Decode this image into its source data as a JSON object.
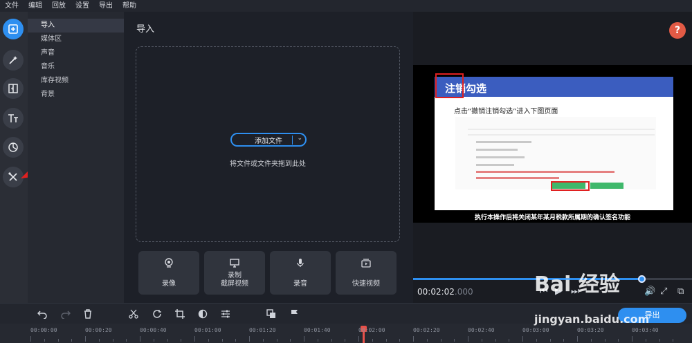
{
  "menu": [
    "文件",
    "编辑",
    "回放",
    "设置",
    "导出",
    "帮助"
  ],
  "sidebar": {
    "items": [
      {
        "label": "导入"
      },
      {
        "label": "媒体区"
      },
      {
        "label": "声音"
      },
      {
        "label": "音乐"
      },
      {
        "label": "库存视频"
      },
      {
        "label": "背景"
      }
    ]
  },
  "main": {
    "title": "导入",
    "add_files_label": "添加文件",
    "drop_hint": "将文件或文件夹拖到此处",
    "tiles": [
      {
        "label": "录像"
      },
      {
        "label": "录制\n截屏视频"
      },
      {
        "label": "录音"
      },
      {
        "label": "快速视频"
      }
    ]
  },
  "preview": {
    "help_label": "?",
    "slide_title": "注销勾选",
    "slide_subtitle": "点击“撤销注销勾选”进入下图页面",
    "caption": "执行本操作后将关闭某年某月税款所属期的确认签名功能",
    "timecode_main": "00:02:02",
    "timecode_ms": ".000",
    "progress": 0.82
  },
  "toolbar": {
    "export_label": "导出"
  },
  "timeline": {
    "ruler": [
      "00:00:00",
      "00:00:20",
      "00:00:40",
      "00:01:00",
      "00:01:20",
      "00:01:40",
      "00:02:00",
      "00:02:20",
      "00:02:40",
      "00:03:00",
      "00:03:20",
      "00:03:40"
    ]
  },
  "watermark": {
    "line1": "Bai 经验",
    "line2": "jingyan.baidu.com"
  },
  "colors": {
    "accent": "#2e8ff0",
    "help": "#e25a45",
    "playhead": "#e8514a",
    "annotation": "#e02020"
  }
}
